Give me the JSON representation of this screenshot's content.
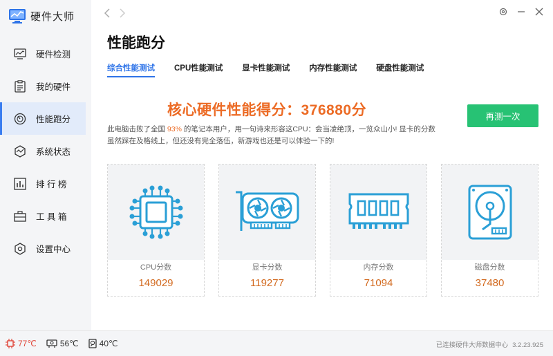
{
  "app": {
    "name": "硬件大师"
  },
  "sidebar": {
    "items": [
      {
        "label": "硬件检测",
        "icon": "monitor-chart-icon",
        "active": false
      },
      {
        "label": "我的硬件",
        "icon": "clipboard-icon",
        "active": false
      },
      {
        "label": "性能跑分",
        "icon": "speedometer-icon",
        "active": true
      },
      {
        "label": "系统状态",
        "icon": "pulse-icon",
        "active": false
      },
      {
        "label": "排 行 榜",
        "icon": "bar-chart-icon",
        "active": false
      },
      {
        "label": "工 具 箱",
        "icon": "toolbox-icon",
        "active": false
      },
      {
        "label": "设置中心",
        "icon": "hexagon-settings-icon",
        "active": false
      }
    ]
  },
  "page": {
    "title": "性能跑分"
  },
  "tabs": [
    {
      "label": "综合性能测试",
      "active": true
    },
    {
      "label": "CPU性能测试",
      "active": false
    },
    {
      "label": "显卡性能测试",
      "active": false
    },
    {
      "label": "内存性能测试",
      "active": false
    },
    {
      "label": "硬盘性能测试",
      "active": false
    }
  ],
  "score": {
    "text": "核心硬件性能得分：376880分"
  },
  "retest": {
    "label": "再测一次"
  },
  "description": {
    "pre": "此电脑击败了全国 ",
    "percent": "93%",
    "post": " 的笔记本用户，用一句诗来形容这CPU：会当凌绝顶，一览众山小! 显卡的分数虽然踩在及格线上，但还没有完全落伍，新游戏也还是可以体验一下的!"
  },
  "cards": [
    {
      "label": "CPU分数",
      "value": "149029",
      "icon": "cpu-chip-icon"
    },
    {
      "label": "显卡分数",
      "value": "119277",
      "icon": "graphics-card-icon"
    },
    {
      "label": "内存分数",
      "value": "71094",
      "icon": "memory-module-icon"
    },
    {
      "label": "磁盘分数",
      "value": "37480",
      "icon": "hard-disk-icon"
    }
  ],
  "status": {
    "temps": [
      {
        "value": "77℃",
        "icon": "cpu-temp-icon"
      },
      {
        "value": "56℃",
        "icon": "gpu-temp-icon"
      },
      {
        "value": "40℃",
        "icon": "disk-temp-icon"
      }
    ],
    "connection": "已连接硬件大师数据中心",
    "version": "3.2.23.925"
  },
  "colors": {
    "accent": "#2f74e8",
    "score": "#ec6b25",
    "button": "#27c274",
    "icon": "#2a9fd6",
    "hot": "#e0463a"
  }
}
